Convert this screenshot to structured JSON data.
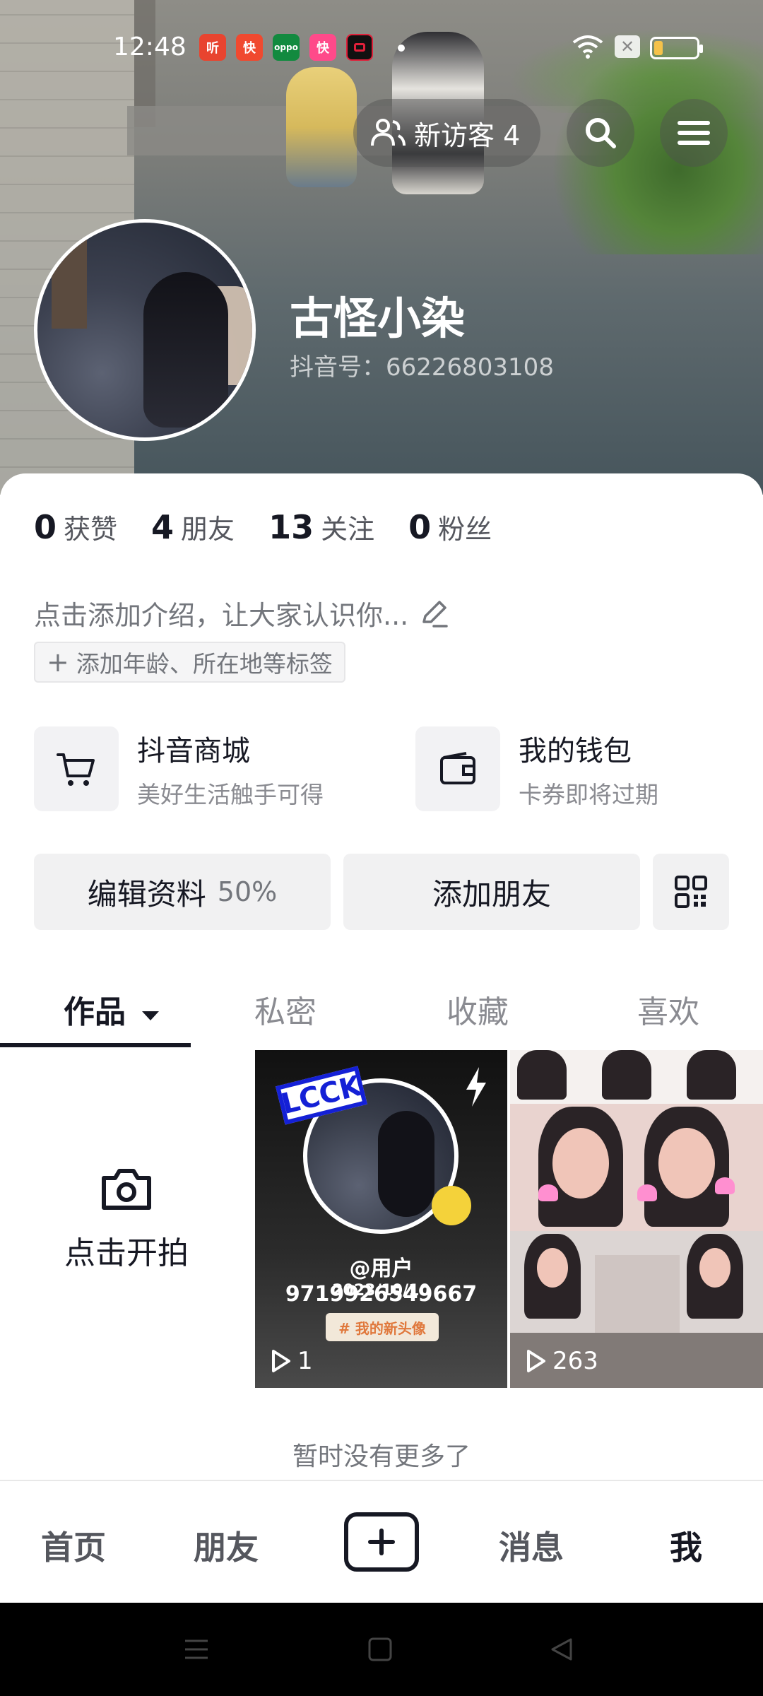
{
  "status_bar": {
    "time": "12:48",
    "apps": [
      {
        "name": "听",
        "color": "#e8442f"
      },
      {
        "name": "快",
        "color": "#f0492f"
      },
      {
        "name": "oppo",
        "color": "#128a3f"
      },
      {
        "name": "快",
        "color": "#ff4a8a"
      },
      {
        "name": "",
        "color": "#e0203a"
      }
    ]
  },
  "header": {
    "visitors_label": "新访客 4"
  },
  "profile": {
    "name": "古怪小染",
    "douyin_id": "抖音号：66226803108"
  },
  "stats": [
    {
      "num": "0",
      "label": "获赞"
    },
    {
      "num": "4",
      "label": "朋友"
    },
    {
      "num": "13",
      "label": "关注"
    },
    {
      "num": "0",
      "label": "粉丝"
    }
  ],
  "bio": {
    "placeholder": "点击添加介绍，让大家认识你...",
    "tag_chip": "添加年龄、所在地等标签"
  },
  "services": {
    "mall": {
      "title": "抖音商城",
      "subtitle": "美好生活触手可得"
    },
    "wallet": {
      "title": "我的钱包",
      "subtitle": "卡券即将过期"
    }
  },
  "actions": {
    "edit": "编辑资料",
    "edit_pct": "50%",
    "add_friend": "添加朋友"
  },
  "tabs": [
    "作品",
    "私密",
    "收藏",
    "喜欢"
  ],
  "grid": {
    "shoot_label": "点击开拍",
    "videos": [
      {
        "badge": "LCCK",
        "user": "@用户9719926549667",
        "date": "2023/10/10",
        "hashtag": "# 我的新头像",
        "plays": "1"
      },
      {
        "plays": "263"
      }
    ],
    "no_more": "暂时没有更多了"
  },
  "bottom_nav": {
    "home": "首页",
    "friends": "朋友",
    "messages": "消息",
    "me": "我"
  }
}
